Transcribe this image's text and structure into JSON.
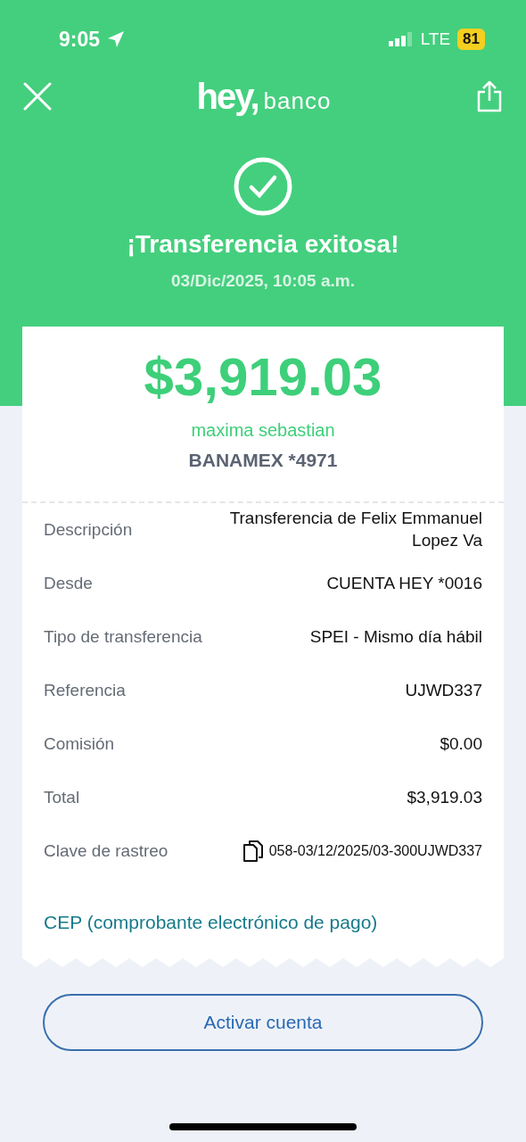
{
  "status_bar": {
    "time": "9:05",
    "network": "LTE",
    "battery": "81"
  },
  "header": {
    "logo_word": "hey,",
    "logo_suffix": "banco",
    "title": "¡Transferencia exitosa!",
    "date": "03/Dic/2025, 10:05 a.m."
  },
  "receipt": {
    "amount": "$3,919.03",
    "recipient": "maxima sebastian",
    "account": "BANAMEX *4971",
    "details": [
      {
        "kind": "text",
        "label": "Descripción",
        "value": "Transferencia de Felix Emmanuel Lopez Va"
      },
      {
        "kind": "text",
        "label": "Desde",
        "value": "CUENTA HEY *0016"
      },
      {
        "kind": "text",
        "label": "Tipo de transferencia",
        "value": "SPEI - Mismo día hábil"
      },
      {
        "kind": "text",
        "label": "Referencia",
        "value": "UJWD337"
      },
      {
        "kind": "text",
        "label": "Comisión",
        "value": "$0.00"
      },
      {
        "kind": "text",
        "label": "Total",
        "value": "$3,919.03"
      },
      {
        "kind": "copy",
        "label": "Clave de rastreo",
        "value": "058-03/12/2025/03-300UJWD337"
      }
    ],
    "link": "CEP (comprobante electrónico de pago)"
  },
  "button": "Activar cuenta"
}
